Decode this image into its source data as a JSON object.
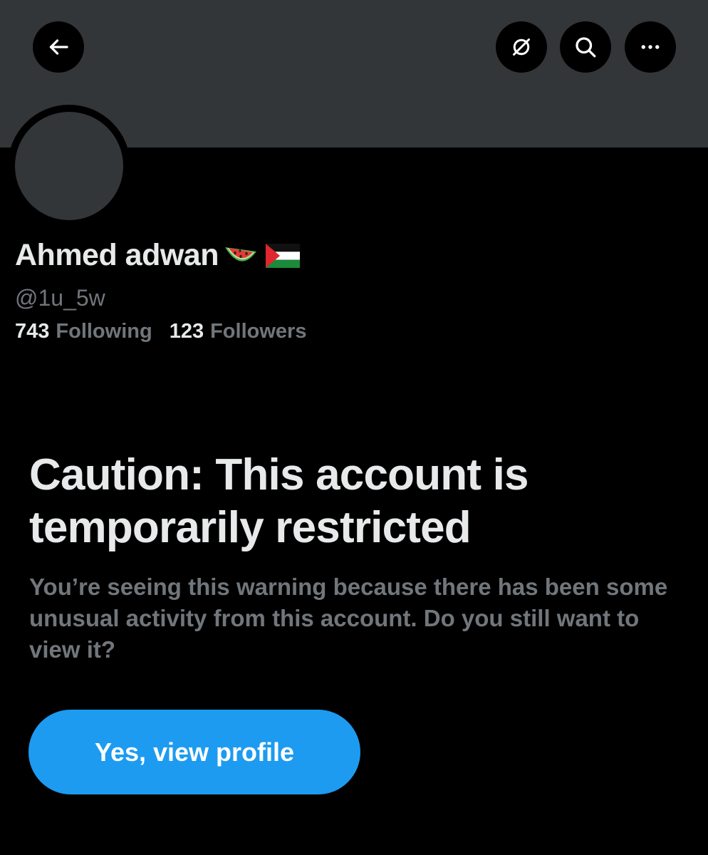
{
  "header": {
    "back_icon": "arrow-left-icon",
    "grok_icon": "slashed-circle-icon",
    "search_icon": "search-icon",
    "more_icon": "more-horizontal-icon"
  },
  "profile": {
    "name": "Ahmed adwan",
    "name_emojis": [
      "watermelon-emoji",
      "palestine-flag-emoji"
    ],
    "handle": "@1u_5w",
    "following_count": "743",
    "following_label": "Following",
    "followers_count": "123",
    "followers_label": "Followers"
  },
  "warning": {
    "title": "Caution: This account is temporarily restricted",
    "message": "You’re seeing this warning because there has been some unusual activity from this account. Do you still want to view it?",
    "button_label": "Yes, view profile"
  },
  "colors": {
    "background": "#000000",
    "banner": "#333639",
    "primary_text": "#e7e9ea",
    "secondary_text": "#71767b",
    "accent": "#1d9bf0"
  }
}
